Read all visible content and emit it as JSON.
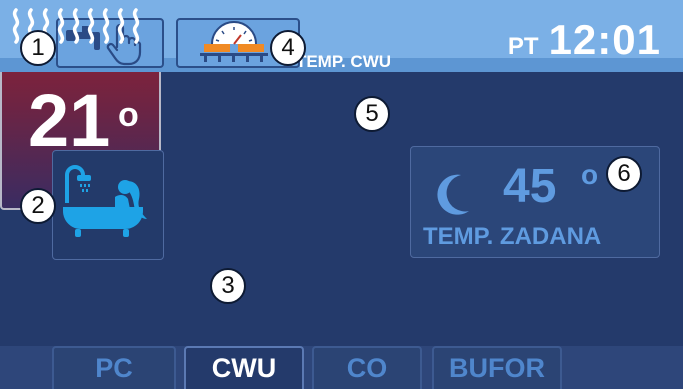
{
  "header": {
    "day": "PT",
    "time": "12:01"
  },
  "hot_water": {
    "label": "TEMP. CWU",
    "temperature": "21",
    "degree": "o"
  },
  "setpoint": {
    "value": "45",
    "degree": "o",
    "label": "TEMP. ZADANA"
  },
  "tabs": [
    {
      "label": "PC"
    },
    {
      "label": "CWU"
    },
    {
      "label": "CO"
    },
    {
      "label": "BUFOR"
    }
  ],
  "active_tab": "CWU",
  "badges": [
    "1",
    "2",
    "3",
    "4",
    "5",
    "6"
  ],
  "icons": {
    "tap": "faucet-icon",
    "hand": "hand-pointer-icon",
    "heater": "heater-gauge-icon",
    "bath": "bath-shower-icon",
    "waves": "heat-waves-icon",
    "moon": "moon-icon"
  },
  "colors": {
    "background": "#243a6b",
    "topbar": "#7bb0e6",
    "accent_blue": "#5f9be0",
    "hot_red": "#9a2030"
  }
}
